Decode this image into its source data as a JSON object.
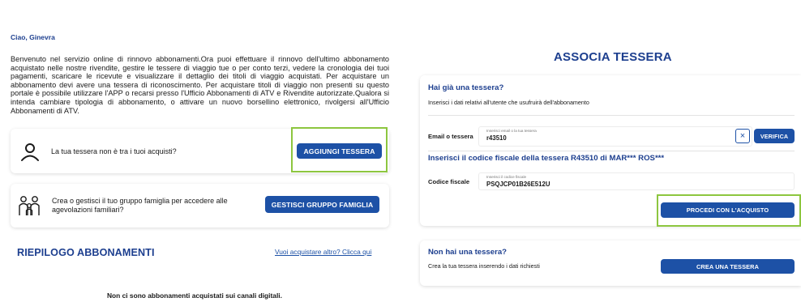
{
  "left": {
    "greeting": "Ciao, Ginevra",
    "intro": "Benvenuto nel servizio online di rinnovo abbonamenti.Ora puoi effettuare il rinnovo dell'ultimo abbonamento acquistato nelle nostre rivendite, gestire le tessere di viaggio tue o per conto terzi, vedere la cronologia dei tuoi pagamenti, scaricare le ricevute e visualizzare il dettaglio dei titoli di viaggio acquistati. Per acquistare un abbonamento devi avere una tessera di riconoscimento. Per acquistare titoli di viaggio non presenti su questo portale è possibile utilizzare l'APP o recarsi presso l'Ufficio Abbonamenti di ATV e Rivendite autorizzate.Qualora si intenda cambiare tipologia di abbonamento, o attivare un nuovo borsellino elettronico, rivolgersi all'Ufficio Abbonamenti di ATV.",
    "tessera_card": {
      "text": "La tua tessera non è tra i tuoi acquisti?",
      "button": "AGGIUNGI TESSERA",
      "icon": "user-icon"
    },
    "famiglia_card": {
      "text_line1": "Crea o gestisci il tuo gruppo famiglia per accedere alle",
      "text_line2": "agevolazioni familiari?",
      "button": "GESTISCI GRUPPO FAMIGLIA",
      "icon": "family-icon"
    },
    "riepilogo_title": "RIEPILOGO ABBONAMENTI",
    "riepilogo_link": "Vuoi acquistare altro? Clicca qui",
    "empty_message": "Non ci sono abbonamenti acquistati sui canali digitali."
  },
  "right": {
    "title": "ASSOCIA TESSERA",
    "has_card_title": "Hai già una tessera?",
    "has_card_subtitle": "Inserisci i dati relativi all'utente che usufruirà dell'abbonamento",
    "email_label": "Email o tessera",
    "email_placeholder": "Inserisci email o la tua tessera",
    "email_value": "r43510",
    "clear_icon": "close-icon",
    "verify_button": "VERIFICA",
    "cf_title": "Inserisci il codice fiscale della tessera R43510 di MAR*** ROS***",
    "cf_label": "Codice fiscale",
    "cf_placeholder": "Inserisci il codice fiscale",
    "cf_value": "PSQJCP01B26E512U",
    "proceed_button": "PROCEDI CON L'ACQUISTO",
    "no_card_title": "Non hai una tessera?",
    "no_card_text": "Crea la tua tessera inserendo i dati richiesti",
    "create_button": "CREA UNA TESSERA"
  },
  "colors": {
    "primary_blue": "#1d51a6",
    "title_blue": "#1d3f8f",
    "highlight_green": "#8dc63f"
  }
}
